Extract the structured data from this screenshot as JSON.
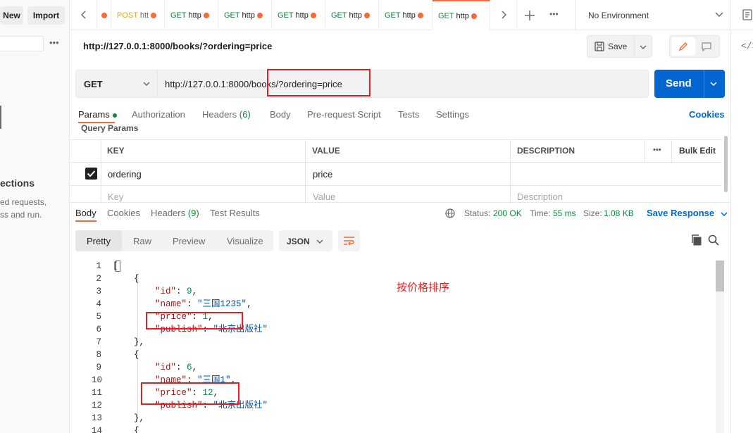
{
  "sidebar": {
    "new_label": "New",
    "import_label": "Import",
    "empty_title": "ections",
    "empty_desc_1": "ed requests,",
    "empty_desc_2": "ss and run."
  },
  "tabs": [
    {
      "method": "POST",
      "label": "htt"
    },
    {
      "method": "GET",
      "label": "http"
    },
    {
      "method": "GET",
      "label": "http"
    },
    {
      "method": "GET",
      "label": "http"
    },
    {
      "method": "GET",
      "label": "http"
    },
    {
      "method": "GET",
      "label": "http"
    },
    {
      "method": "GET",
      "label": "http"
    }
  ],
  "environment": "No Environment",
  "request": {
    "title": "http://127.0.0.1:8000/books/?ordering=price",
    "save_label": "Save",
    "method": "GET",
    "url": "http://127.0.0.1:8000/books/?ordering=price",
    "send_label": "Send"
  },
  "request_tabs": {
    "params": "Params",
    "authorization": "Authorization",
    "headers": "Headers",
    "headers_count": "(6)",
    "body": "Body",
    "prerequest": "Pre-request Script",
    "tests": "Tests",
    "settings": "Settings",
    "cookies": "Cookies"
  },
  "query_params": {
    "title": "Query Params",
    "col_key": "KEY",
    "col_value": "VALUE",
    "col_description": "DESCRIPTION",
    "bulk_edit": "Bulk Edit",
    "row_key": "ordering",
    "row_value": "price",
    "ph_key": "Key",
    "ph_value": "Value",
    "ph_description": "Description"
  },
  "response": {
    "body": "Body",
    "cookies": "Cookies",
    "headers": "Headers",
    "headers_count": "(9)",
    "test_results": "Test Results",
    "status_label": "Status:",
    "status_value": "200 OK",
    "time_label": "Time:",
    "time_value": "55 ms",
    "size_label": "Size:",
    "size_value": "1.08 KB",
    "save_response": "Save Response",
    "view_pretty": "Pretty",
    "view_raw": "Raw",
    "view_preview": "Preview",
    "view_visualize": "Visualize",
    "format": "JSON"
  },
  "annotation": "按价格排序",
  "colors": {
    "accent": "#f26b3a",
    "primary": "#0265d2",
    "status_ok": "#0b8a3b",
    "annotation": "#e02020"
  }
}
